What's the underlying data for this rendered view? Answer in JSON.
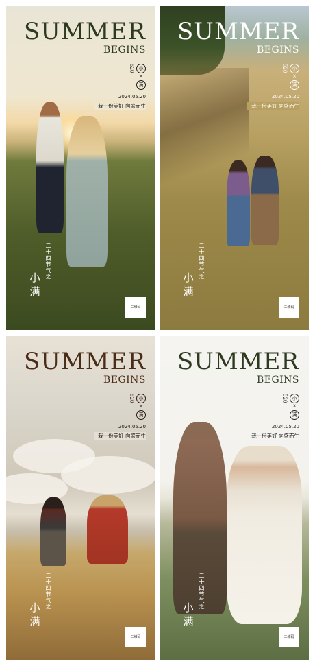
{
  "posters": [
    {
      "title": "SUMMER",
      "subtitle": "BEGINS",
      "badge_numbers": "520",
      "badge_x": "×",
      "badge_top": "小",
      "badge_bottom": "满",
      "date": "2024.05.20",
      "slogan": "栽一份美好 向盛而生",
      "tag": "二十四节气之",
      "small": "小",
      "full": "满",
      "qr": "二维码"
    },
    {
      "title": "SUMMER",
      "subtitle": "BEGINS",
      "badge_numbers": "520",
      "badge_x": "×",
      "badge_top": "小",
      "badge_bottom": "满",
      "date": "2024.05.20",
      "slogan": "栽一份美好 向盛而生",
      "tag": "二十四节气之",
      "small": "小",
      "full": "满",
      "qr": "二维码"
    },
    {
      "title": "SUMMER",
      "subtitle": "BEGINS",
      "badge_numbers": "520",
      "badge_x": "×",
      "badge_top": "小",
      "badge_bottom": "满",
      "date": "2024.05.20",
      "slogan": "栽一份美好 向盛而生",
      "tag": "二十四节气之",
      "small": "小",
      "full": "满",
      "qr": "二维码"
    },
    {
      "title": "SUMMER",
      "subtitle": "BEGINS",
      "badge_numbers": "520",
      "badge_x": "×",
      "badge_top": "小",
      "badge_bottom": "满",
      "date": "2024.05.20",
      "slogan": "栽一份美好 向盛而生",
      "tag": "二十四节气之",
      "small": "小",
      "full": "满",
      "qr": "二维码"
    }
  ],
  "colors": {
    "dark_text": "#2e3a1f",
    "brown_text": "#4a2c17",
    "light_text": "#ffffff"
  }
}
